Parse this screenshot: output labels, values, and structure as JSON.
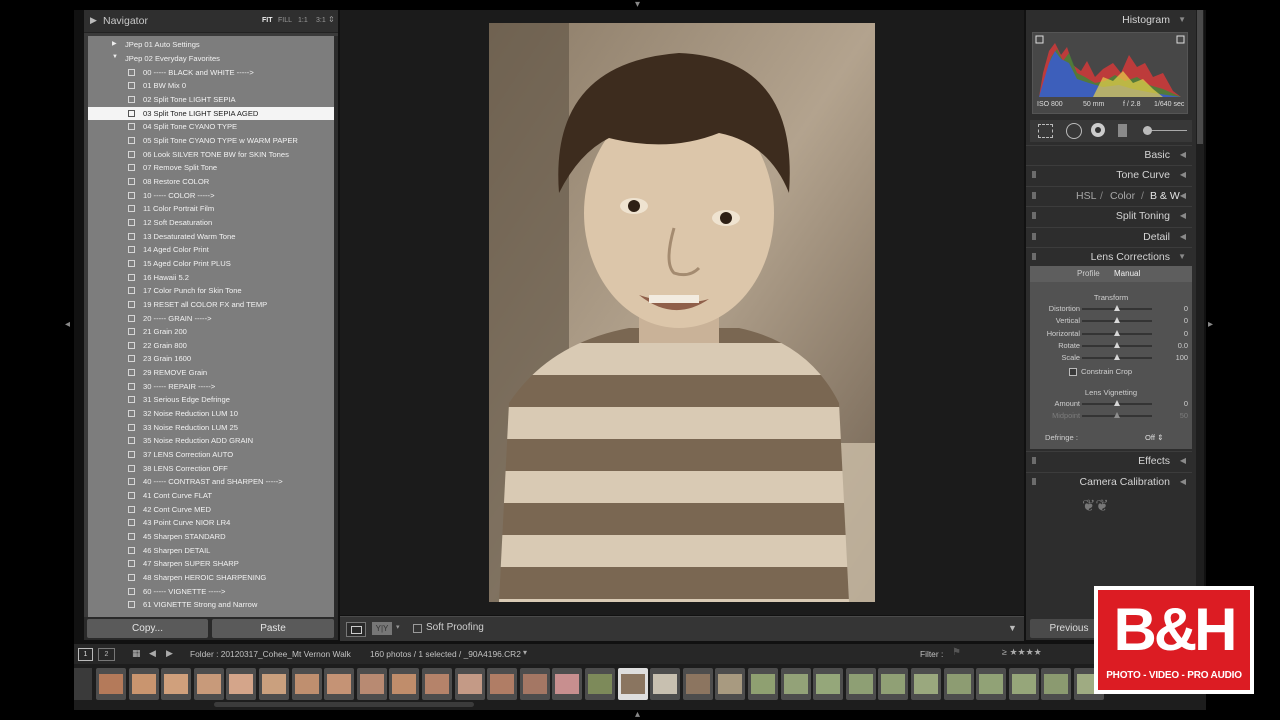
{
  "navigator": {
    "title": "Navigator",
    "zoom_options": [
      {
        "label": "FIT",
        "active": true
      },
      {
        "label": "FILL",
        "active": false
      },
      {
        "label": "1:1",
        "active": false
      },
      {
        "label": "3:1",
        "active": false
      }
    ]
  },
  "presets": {
    "folders": [
      {
        "label": "JPep 01 Auto Settings",
        "expanded": false
      },
      {
        "label": "JPep 02 Everyday Favorites",
        "expanded": true
      }
    ],
    "items": [
      "00 ----- BLACK and WHITE ----->",
      "01 BW Mix 0",
      "02 Split Tone LIGHT SEPIA",
      "03 Split Tone LIGHT SEPIA AGED",
      "04 Split Tone CYANO TYPE",
      "05 Split Tone CYANO TYPE w WARM PAPER",
      "06 Look SILVER TONE BW for SKIN Tones",
      "07 Remove Split Tone",
      "08 Restore COLOR",
      "10 ----- COLOR ----->",
      "11 Color Portrait Film",
      "12 Soft Desaturation",
      "13 Desaturated Warm Tone",
      "14 Aged Color Print",
      "15 Aged Color Print PLUS",
      "16 Hawaii 5.2",
      "17 Color Punch for Skin Tone",
      "19 RESET all COLOR FX and TEMP",
      "20 ----- GRAIN ----->",
      "21 Grain 200",
      "22 Grain 800",
      "23 Grain 1600",
      "29 REMOVE Grain",
      "30 ----- REPAIR ----->",
      "31 Serious Edge Defringe",
      "32 Noise Reduction LUM 10",
      "33 Noise Reduction LUM 25",
      "35 Noise Reduction ADD GRAIN",
      "37 LENS Correction AUTO",
      "38 LENS Correction OFF",
      "40 ----- CONTRAST and SHARPEN ----->",
      "41 Cont Curve FLAT",
      "42 Cont Curve MED",
      "43 Point Curve NIOR LR4",
      "45 Sharpen STANDARD",
      "46 Sharpen DETAIL",
      "47 Sharpen SUPER SHARP",
      "48 Sharpen HEROIC SHARPENING",
      "60 ----- VIGNETTE ----->",
      "61 VIGNETTE Strong and Narrow"
    ],
    "selected_index": 3
  },
  "copy_paste": {
    "copy": "Copy...",
    "paste": "Paste"
  },
  "toolbar": {
    "soft_proofing": "Soft Proofing"
  },
  "histogram": {
    "title": "Histogram",
    "iso": "ISO 800",
    "focal": "50 mm",
    "aperture": "f / 2.8",
    "shutter": "1/640 sec"
  },
  "panels": {
    "basic": "Basic",
    "tone_curve": "Tone Curve",
    "hsl": "HSL",
    "sep1": "/",
    "color": "Color",
    "sep2": "/",
    "bw": "B & W",
    "split_toning": "Split Toning",
    "detail": "Detail",
    "lens_corrections": "Lens Corrections",
    "effects": "Effects",
    "camera_calibration": "Camera Calibration"
  },
  "lens": {
    "tabs": [
      {
        "label": "Profile",
        "active": false
      },
      {
        "label": "Manual",
        "active": true
      }
    ],
    "transform_title": "Transform",
    "sliders": [
      {
        "name": "Distortion",
        "value": "0",
        "position": 0.5
      },
      {
        "name": "Vertical",
        "value": "0",
        "position": 0.5
      },
      {
        "name": "Horizontal",
        "value": "0",
        "position": 0.5
      },
      {
        "name": "Rotate",
        "value": "0.0",
        "position": 0.5
      },
      {
        "name": "Scale",
        "value": "100",
        "position": 0.5
      }
    ],
    "constrain_crop": "Constrain Crop",
    "vignetting_title": "Lens Vignetting",
    "vignetting": [
      {
        "name": "Amount",
        "value": "0",
        "position": 0.5,
        "dim": false
      },
      {
        "name": "Midpoint",
        "value": "50",
        "position": 0.5,
        "dim": true
      }
    ],
    "defringe_label": "Defringe :",
    "defringe_value": "Off"
  },
  "previous_button": "Previous",
  "filmstrip": {
    "monitor1": "1",
    "monitor2": "2",
    "folder": "Folder : 20120317_Cohee_Mt Vernon Walk",
    "count": "160 photos / 1 selected / _90A4196.CR2",
    "filter_label": "Filter :"
  },
  "logo": {
    "big": "B&H",
    "small": "PHOTO - VIDEO - PRO AUDIO"
  },
  "colors": {
    "panel_bg": "#2d2d2d",
    "preset_bg": "#7d7d7d",
    "logo_red": "#dc1c23"
  }
}
